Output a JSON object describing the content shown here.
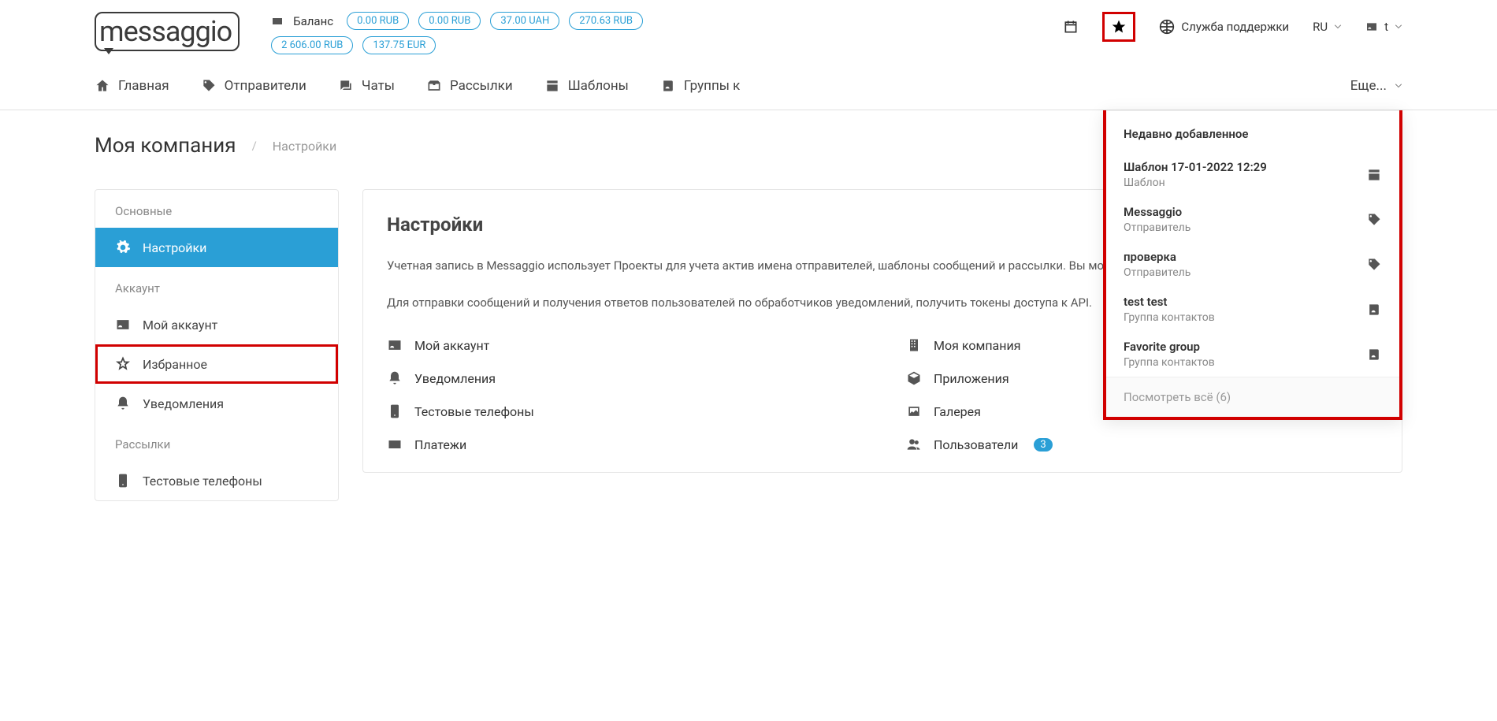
{
  "header": {
    "logo_text": "messaggio",
    "balance_label": "Баланс",
    "balances": [
      "0.00 RUB",
      "0.00 RUB",
      "37.00 UAH",
      "270.63 RUB",
      "2 606.00 RUB",
      "137.75 EUR"
    ],
    "support_label": "Служба поддержки",
    "lang": "RU",
    "user_label": "t"
  },
  "nav": {
    "items": [
      {
        "label": "Главная",
        "icon": "home"
      },
      {
        "label": "Отправители",
        "icon": "tag"
      },
      {
        "label": "Чаты",
        "icon": "chat"
      },
      {
        "label": "Рассылки",
        "icon": "inbox"
      },
      {
        "label": "Шаблоны",
        "icon": "template"
      },
      {
        "label": "Группы к",
        "icon": "contacts"
      }
    ],
    "more_label": "Еще..."
  },
  "breadcrumb": {
    "main": "Моя компания",
    "sub": "Настройки"
  },
  "sidebar": {
    "sections": [
      {
        "title": "Основные",
        "items": [
          {
            "label": "Настройки",
            "icon": "gear",
            "active": true
          }
        ]
      },
      {
        "title": "Аккаунт",
        "items": [
          {
            "label": "Мой аккаунт",
            "icon": "id"
          },
          {
            "label": "Избранное",
            "icon": "star",
            "highlighted": true
          },
          {
            "label": "Уведомления",
            "icon": "bell"
          }
        ]
      },
      {
        "title": "Рассылки",
        "items": [
          {
            "label": "Тестовые телефоны",
            "icon": "phone"
          }
        ]
      }
    ]
  },
  "main": {
    "title": "Настройки",
    "p1": "Учетная запись в Messaggio использует Проекты для учета актив имена отправителей, шаблоны сообщений и рассылки. Вы може управлять рассылками удобным образом.",
    "p2": "Для отправки сообщений и получения ответов пользователей по обработчиков уведомлений, получить токены доступа к API.",
    "links_left": [
      {
        "label": "Мой аккаунт",
        "icon": "id"
      },
      {
        "label": "Уведомления",
        "icon": "bell"
      },
      {
        "label": "Тестовые телефоны",
        "icon": "phone"
      },
      {
        "label": "Платежи",
        "icon": "card"
      }
    ],
    "links_right": [
      {
        "label": "Моя компания",
        "icon": "building"
      },
      {
        "label": "Приложения",
        "icon": "box"
      },
      {
        "label": "Галерея",
        "icon": "gallery"
      },
      {
        "label": "Пользователи",
        "icon": "users",
        "badge": "3"
      }
    ]
  },
  "dropdown": {
    "title": "Недавно добавленное",
    "items": [
      {
        "title": "Шаблон 17-01-2022 12:29",
        "sub": "Шаблон",
        "icon": "template"
      },
      {
        "title": "Messaggio",
        "sub": "Отправитель",
        "icon": "tag"
      },
      {
        "title": "проверка",
        "sub": "Отправитель",
        "icon": "tag"
      },
      {
        "title": "test test",
        "sub": "Группа контактов",
        "icon": "contacts"
      },
      {
        "title": "Favorite group",
        "sub": "Группа контактов",
        "icon": "contacts"
      }
    ],
    "footer": "Посмотреть всё (6)"
  }
}
